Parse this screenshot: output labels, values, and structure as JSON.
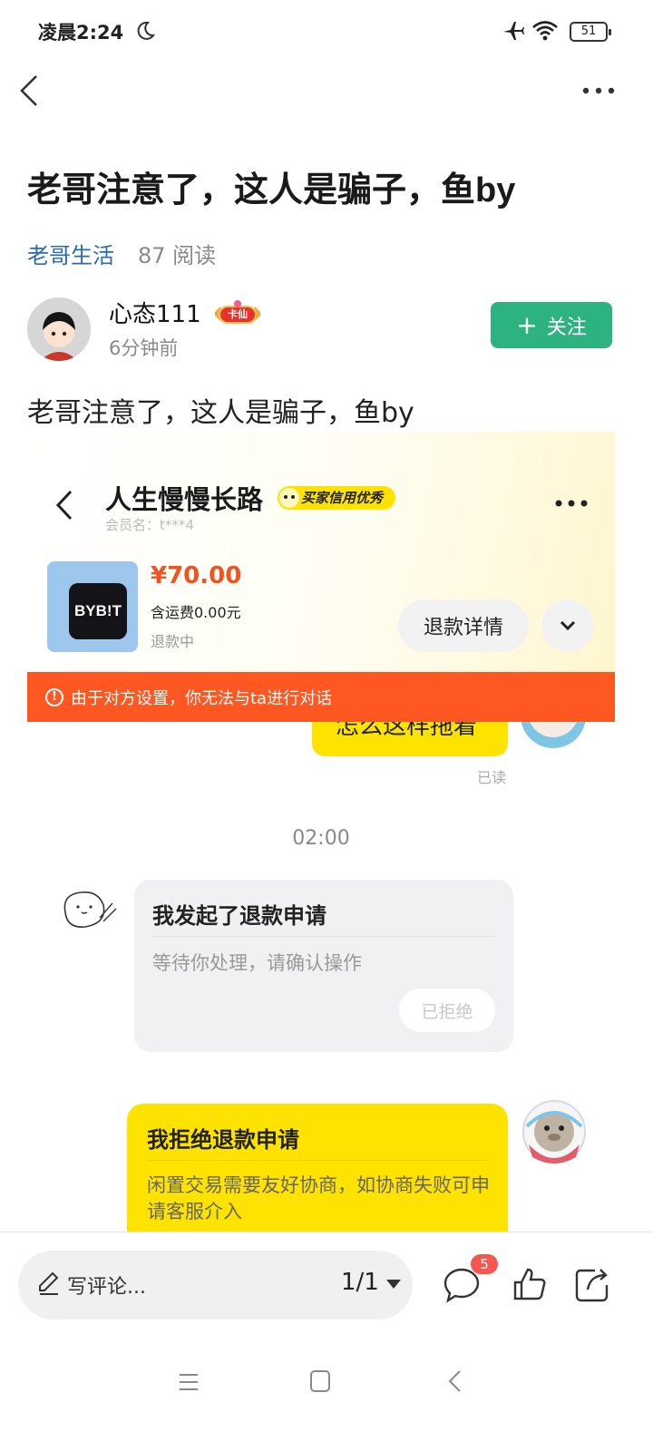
{
  "status_bar": {
    "time": "凌晨2:24",
    "battery": "51"
  },
  "post": {
    "title": "老哥注意了，这人是骗子，鱼by",
    "circle": "老哥生活",
    "read_count": "87 阅读",
    "author": {
      "name": "心态111",
      "badge": "卡仙",
      "time": "6分钟前"
    },
    "follow_label": "关注",
    "body": "老哥注意了，这人是骗子，鱼by"
  },
  "screenshot": {
    "seller_name": "人生慢慢长路",
    "credit_badge": "买家信用优秀",
    "member_id": "会员名：t***4",
    "product_logo": "BYB!T",
    "price": "¥70.00",
    "shipping": "含运费0.00元",
    "refund_status": "退款中",
    "refund_detail_label": "退款详情",
    "warning": "由于对方设置，你无法与ta进行对话",
    "top_message": "怎么这样拖着",
    "read_label": "已读",
    "time_divider": "02:00",
    "refund_request": {
      "title": "我发起了退款申请",
      "subtitle": "等待你处理，请确认操作",
      "button": "已拒绝"
    },
    "reject": {
      "title": "我拒绝退款申请",
      "text": "闲置交易需要友好协商，如协商失败可申请客服介入"
    }
  },
  "bottom_bar": {
    "comment_placeholder": "写评论...",
    "page_indicator": "1/1",
    "comment_count": "5"
  },
  "colors": {
    "accent_green": "#2db37f",
    "link_blue": "#2b6ab5",
    "warning_orange": "#ff5722",
    "xianyu_yellow": "#ffe300",
    "badge_red": "#f5564e"
  },
  "icons": [
    "moon-icon",
    "airplane-icon",
    "wifi-icon",
    "battery-icon",
    "back-icon",
    "more-icon",
    "chevron-down-icon",
    "info-icon",
    "pencil-icon",
    "comment-icon",
    "thumbs-up-icon",
    "share-icon",
    "menu-icon",
    "home-icon",
    "nav-back-icon"
  ]
}
